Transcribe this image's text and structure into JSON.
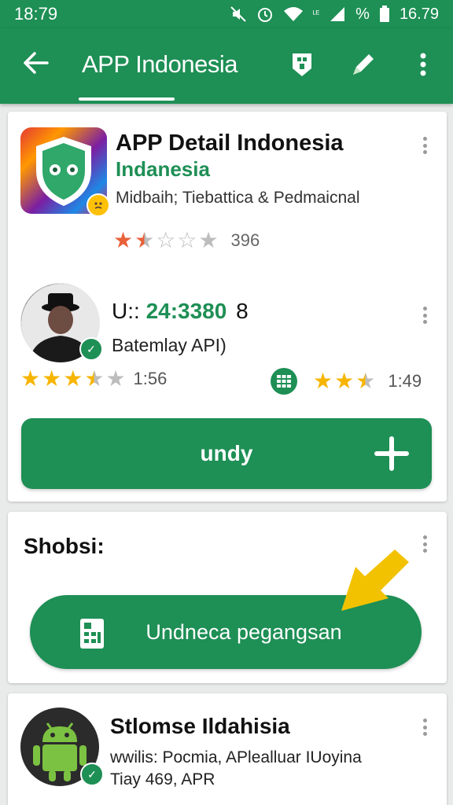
{
  "status_bar": {
    "time": "18:79",
    "signal_text": "ᴸᴱ",
    "battery_percent": "%",
    "right_time": "16.79"
  },
  "app_bar": {
    "title": "APP Indonesia"
  },
  "app_card": {
    "title": "APP Detail Indonesia",
    "subtitle": "Indanesia",
    "category": "Midbaih; Tiebattica & Pedmaicnal",
    "rating_count": "396",
    "rating": 1.5
  },
  "user_card": {
    "id_prefix": "U::",
    "id_number": "24:3380",
    "id_suffix": "8",
    "label": "Batemlay API)",
    "left_time": "1:56",
    "right_time": "1:49",
    "left_rating": 3.5,
    "right_rating": 2.5
  },
  "primary_button": {
    "label": "undy"
  },
  "shortcut_card": {
    "title": "Shobsi:",
    "button_label": "Undneca pegangsan"
  },
  "third_card": {
    "title": "Stlomse Ildahisia",
    "line1": "wwilis: Pocmia, APlealluar IUoyina",
    "line2": "Tiay 469, APR"
  },
  "colors": {
    "brand_green": "#1e8f55",
    "star_yellow": "#f7b500",
    "arrow_yellow": "#f2c200"
  },
  "icons": [
    "back-arrow-icon",
    "tag-icon",
    "edit-icon",
    "more-vert-icon",
    "plus-icon",
    "calculator-icon",
    "android-icon",
    "verified-icon",
    "grid-icon"
  ]
}
